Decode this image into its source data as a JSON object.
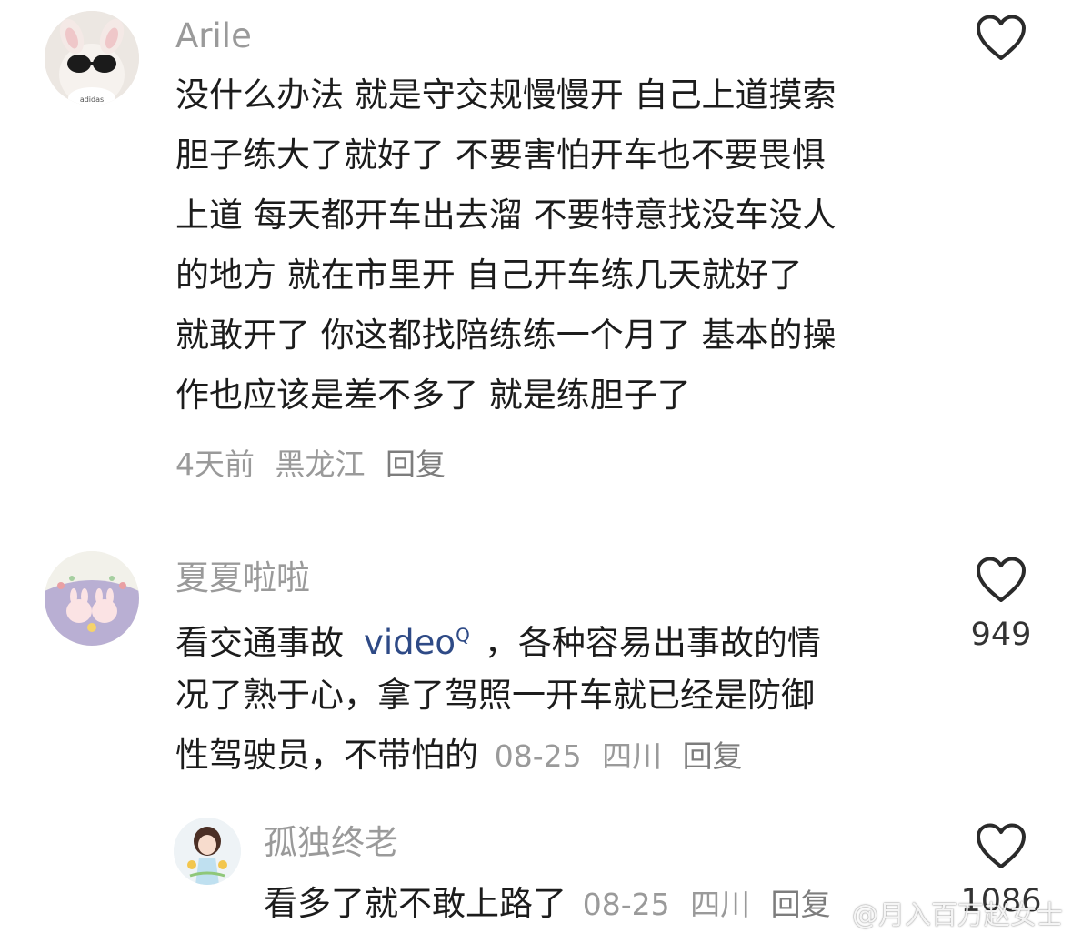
{
  "comments": [
    {
      "username": "Arile",
      "lines": [
        "没什么办法 就是守交规慢慢开 自己上道摸索",
        "胆子练大了就好了 不要害怕开车也不要畏惧",
        "上道 每天都开车出去溜 不要特意找没车没人",
        "的地方 就在市里开 自己开车练几天就好了",
        "就敢开了 你这都找陪练练一个月了 基本的操",
        "作也应该是差不多了 就是练胆子了"
      ],
      "time": "4天前",
      "location": "黑龙江",
      "reply": "回复",
      "likes": ""
    },
    {
      "username": "夏夏啦啦",
      "line1_before": "看交通事故",
      "link_text": "video",
      "link_icon": "Q",
      "line1_after": "，各种容易出事故的情",
      "line2": "况了熟于心，拿了驾照一开车就已经是防御",
      "line3": "性驾驶员，不带怕的",
      "time": "08-25",
      "location": "四川",
      "reply": "回复",
      "likes": "949"
    },
    {
      "username": "孤独终老",
      "line1": "看多了就不敢上路了",
      "time": "08-25",
      "location": "四川",
      "reply": "回复",
      "likes": "1086"
    }
  ],
  "watermark": "@月入百万赵女士",
  "colors": {
    "username": "#9a9a9a",
    "text": "#1c1c1c",
    "meta": "#9a9a9a",
    "link": "#2e4a86",
    "heart": "#2a2a2a"
  }
}
